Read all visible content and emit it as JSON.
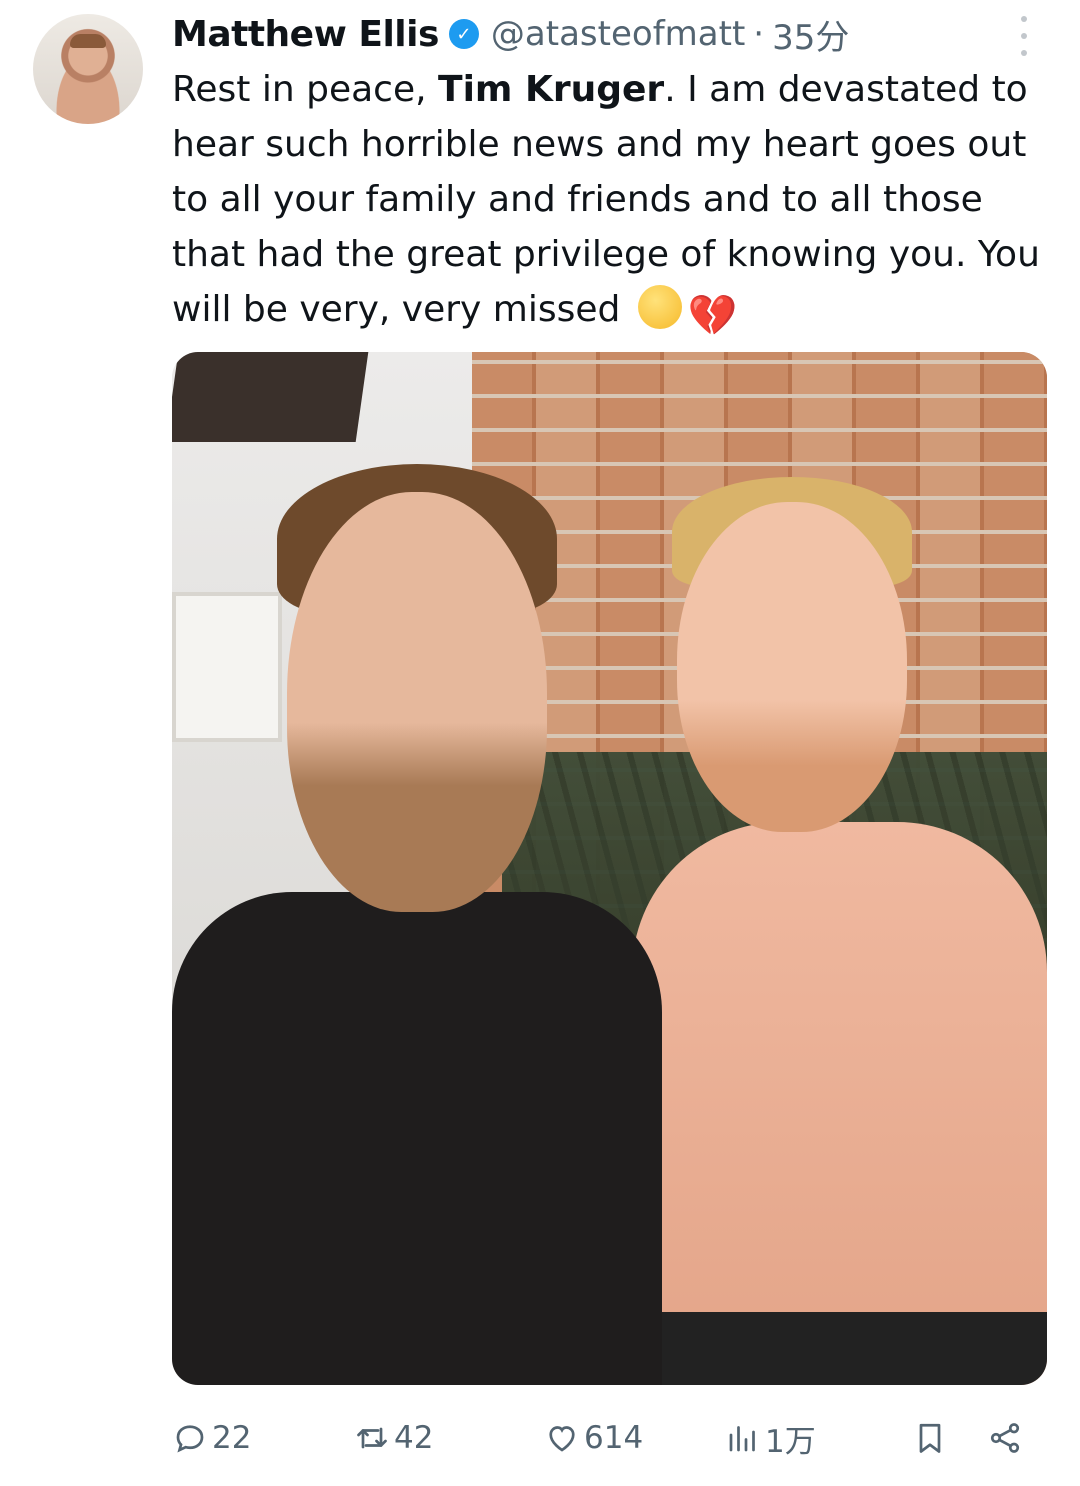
{
  "author": {
    "name": "Matthew Ellis",
    "handle": "@atasteofmatt",
    "separator": "·",
    "time": "35分",
    "verified_color": "#1d9bf0"
  },
  "tweet": {
    "text_part1": "Rest in peace, ",
    "text_bold": "Tim Kruger",
    "text_part2": ". I am devastated to hear such horrible news and my heart goes out to all your family and friends and to all those that had the great privilege of knowing you. You will be very, very missed ",
    "emojis": [
      "pensive-face",
      "broken-heart"
    ]
  },
  "actions": {
    "replies": "22",
    "retweets": "42",
    "likes": "614",
    "views": "1万"
  },
  "colors": {
    "text": "#0f1419",
    "secondary": "#536471",
    "accent": "#1d9bf0"
  }
}
